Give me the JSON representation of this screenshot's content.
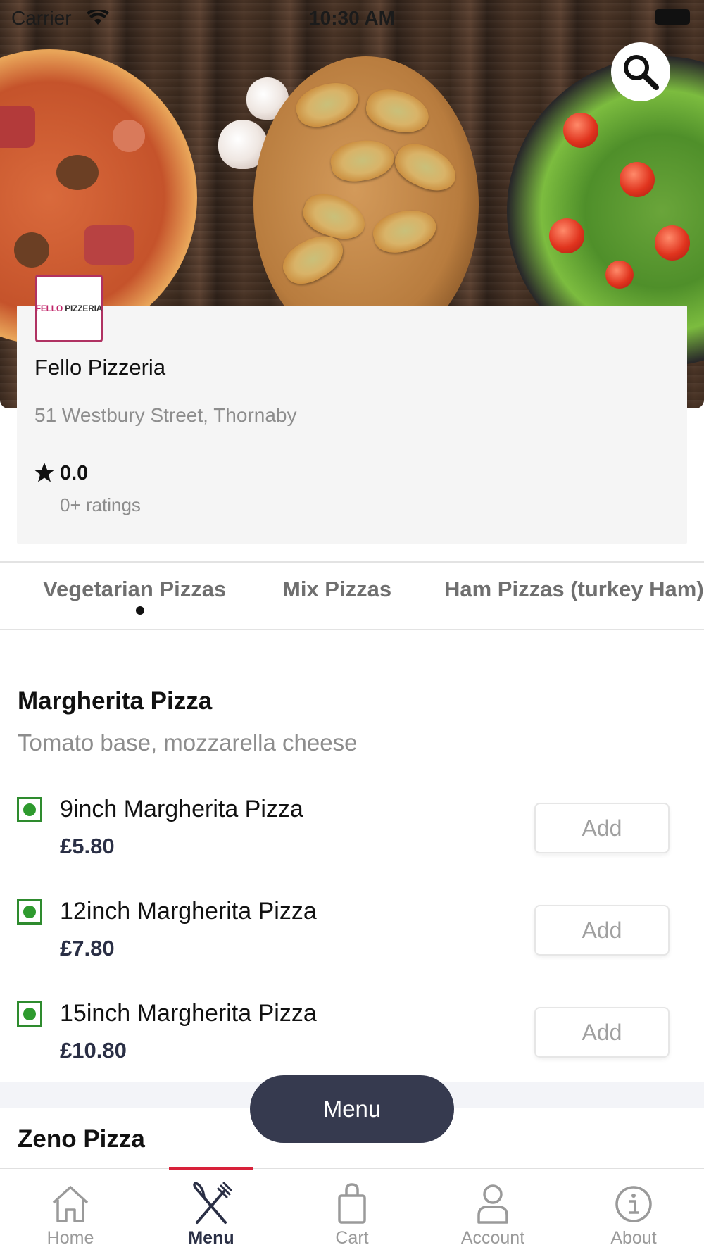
{
  "status_bar": {
    "carrier": "Carrier",
    "time": "10:30 AM"
  },
  "hero": {
    "search_icon": "search-icon"
  },
  "restaurant": {
    "logo_word_1": "FELLO",
    "logo_word_2": "PIZZERIA",
    "name": "Fello Pizzeria",
    "address": "51 Westbury Street, Thornaby",
    "rating": "0.0",
    "rating_count": "0+ ratings"
  },
  "categories": {
    "tabs": [
      "Vegetarian Pizzas",
      "Mix Pizzas",
      "Ham Pizzas (turkey Ham)"
    ],
    "active_index": 0
  },
  "sections": [
    {
      "title": "Margherita Pizza",
      "description": "Tomato base, mozzarella cheese",
      "items": [
        {
          "name": "9inch Margherita Pizza",
          "price": "£5.80",
          "action": "Add"
        },
        {
          "name": "12inch Margherita Pizza",
          "price": "£7.80",
          "action": "Add"
        },
        {
          "name": "15inch Margherita Pizza",
          "price": "£10.80",
          "action": "Add"
        }
      ]
    },
    {
      "title": "Zeno Pizza"
    }
  ],
  "menu_button": "Menu",
  "bottom_nav": {
    "items": [
      {
        "label": "Home",
        "icon": "home-icon"
      },
      {
        "label": "Menu",
        "icon": "fork-knife-icon"
      },
      {
        "label": "Cart",
        "icon": "shopping-bag-icon"
      },
      {
        "label": "Account",
        "icon": "user-icon"
      },
      {
        "label": "About",
        "icon": "info-icon"
      }
    ],
    "active_index": 1
  },
  "colors": {
    "accent": "#d8213a",
    "primary_dark": "#363a4f",
    "veg_green": "#2e8b2e",
    "card_bg": "#f5f5f5"
  }
}
